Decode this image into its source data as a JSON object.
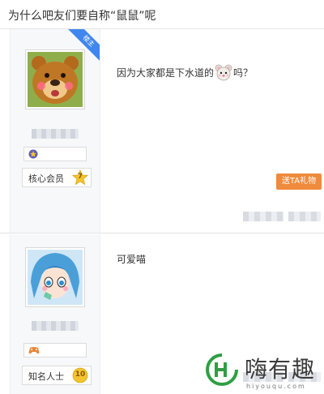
{
  "thread": {
    "title": "为什么吧友们要自称“鼠鼠”呢"
  },
  "posts": [
    {
      "ribbon": "楼主",
      "badge_icon": "star-medal-icon",
      "level_name": "核心会员",
      "level_num": "7",
      "content_before": "因为大家都是下水道的",
      "content_emoji": "mouse-emoji-icon",
      "content_after": "吗？",
      "gift_label": "送TA礼物"
    },
    {
      "badge_icon": "gamepad-icon",
      "level_name": "知名人士",
      "level_num": "10",
      "content": "可爱喵"
    }
  ],
  "watermark": {
    "title": "嗨有趣",
    "url": "hiyouqu.com"
  },
  "colors": {
    "accent_blue": "#3f87ee",
    "gift_orange": "#f08a3c",
    "badge_gold": "#f4c430",
    "brand_green": "#2f9e44"
  }
}
